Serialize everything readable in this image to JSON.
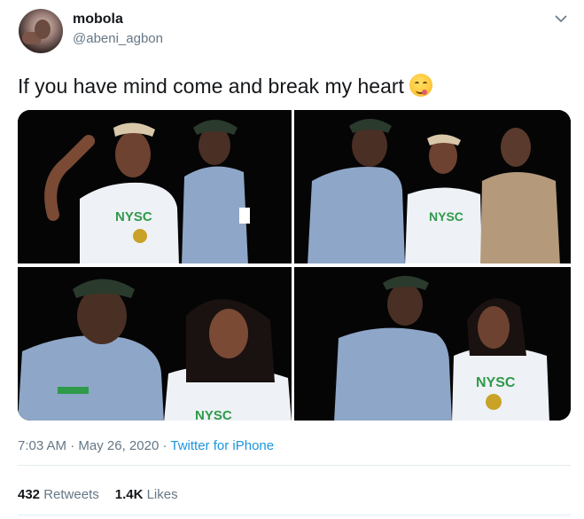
{
  "user": {
    "display_name": "mobola",
    "handle": "@abeni_agbon",
    "avatar": "profile-photo"
  },
  "menu_icon": "chevron-down-icon",
  "tweet": {
    "text": "If you have mind come and break my heart",
    "emoji": "face-savoring-food-emoji"
  },
  "media": {
    "photos": [
      {
        "id": "photo-1",
        "shirt_text": "NYSC"
      },
      {
        "id": "photo-2",
        "shirt_text": "NYSC"
      },
      {
        "id": "photo-3",
        "shirt_text": "NYSC"
      },
      {
        "id": "photo-4",
        "shirt_text": "NYSC"
      }
    ]
  },
  "meta": {
    "time": "7:03 AM",
    "separator": "·",
    "date": "May 26, 2020",
    "source": "Twitter for iPhone"
  },
  "stats": {
    "retweets_count": "432",
    "retweets_label": "Retweets",
    "likes_count": "1.4K",
    "likes_label": "Likes"
  },
  "colors": {
    "text": "#14171a",
    "secondary": "#657786",
    "link": "#1b95e0",
    "divider": "#e6ecf0",
    "nysc_green": "#2f9a4a",
    "uniform_blue": "#8ea6c8"
  }
}
